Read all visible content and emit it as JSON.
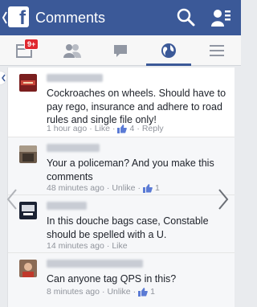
{
  "header": {
    "title": "Comments",
    "logo_letter": "f"
  },
  "tabs": [
    {
      "name": "notifications",
      "badge": "9+"
    },
    {
      "name": "friends"
    },
    {
      "name": "messages"
    },
    {
      "name": "globe",
      "active": true
    },
    {
      "name": "menu"
    }
  ],
  "comments": [
    {
      "text": "Cockroaches on wheels. Should have to pay rego, insurance and adhere to road rules and single file only!",
      "time": "1 hour ago",
      "like_label": "Like",
      "like_count": "4",
      "reply_label": "Reply"
    },
    {
      "text": "Your a policeman? And you make this comments",
      "time": "48 minutes ago",
      "like_label": "Unlike",
      "like_count": "1"
    },
    {
      "text": "In this douche bags case,  Constable should be spelled with a U.",
      "time": "14 minutes ago",
      "like_label": "Like"
    },
    {
      "text": "Can anyone tag QPS in this?",
      "time": "8 minutes ago",
      "like_label": "Unlike",
      "like_count": "1"
    }
  ],
  "colors": {
    "brand": "#3b5998",
    "badge": "#e0272f",
    "meta_text": "#90949c"
  }
}
